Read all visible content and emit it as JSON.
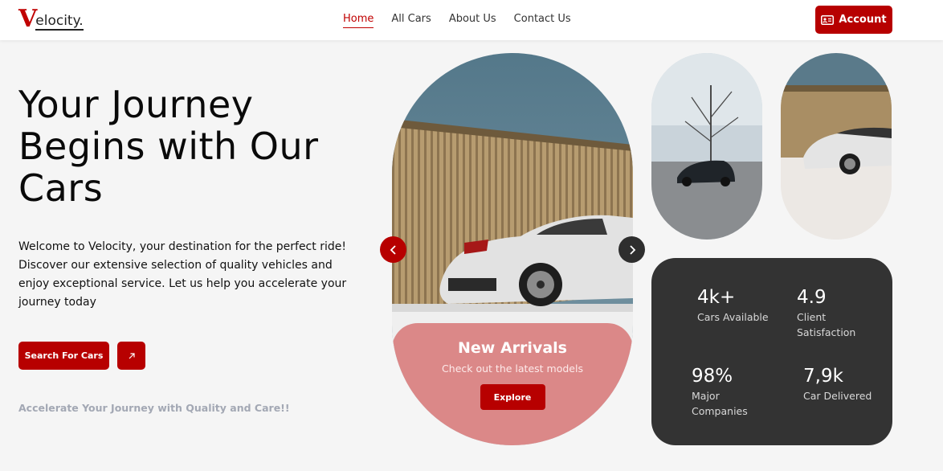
{
  "brand": {
    "mark": "V",
    "name": "elocity."
  },
  "nav": {
    "links": [
      {
        "label": "Home",
        "active": true
      },
      {
        "label": "All Cars",
        "active": false
      },
      {
        "label": "About Us",
        "active": false
      },
      {
        "label": "Contact Us",
        "active": false
      }
    ],
    "account_label": "Account",
    "account_icon": "id-card-icon"
  },
  "hero": {
    "title": "Your Journey Begins with Our Cars",
    "description": "Welcome to Velocity, your destination for the perfect ride! Discover our extensive selection of quality vehicles and enjoy exceptional service. Let us help you accelerate your journey today",
    "search_button": "Search For Cars",
    "arrow_icon": "arrow-up-right-icon",
    "tagline": "Accelerate Your Journey with Quality and Care!!"
  },
  "carousel": {
    "prev_icon": "chevron-left-icon",
    "next_icon": "chevron-right-icon"
  },
  "arrivals": {
    "title": "New Arrivals",
    "subtitle": "Check out the latest models",
    "button": "Explore"
  },
  "stats": [
    {
      "value": "4k+",
      "label": "Cars Available"
    },
    {
      "value": "4.9",
      "label": "Client Satisfaction"
    },
    {
      "value": "98%",
      "label": "Major Companies"
    },
    {
      "value": "7,9k",
      "label": "Car Delivered"
    }
  ],
  "colors": {
    "accent": "#b70000",
    "arrivals_bg": "#d87c7c",
    "stats_bg": "#333333",
    "page_bg": "#f5f5f5",
    "tagline": "#a3a8b4"
  }
}
